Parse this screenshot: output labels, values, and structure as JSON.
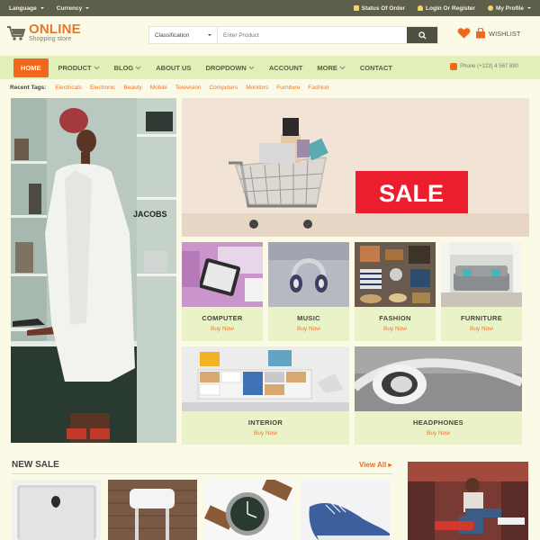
{
  "topbar": {
    "language": "Language",
    "currency": "Currency",
    "status": "Status Of Order",
    "login": "Login Or Register",
    "profile": "My Profile"
  },
  "header": {
    "logo_name": "ONLINE",
    "logo_sub": "Shopping store",
    "search_category": "Classification",
    "search_placeholder": "Enter Product",
    "wishlist": "WISHLIST"
  },
  "nav": {
    "items": [
      "HOME",
      "PRODUCT",
      "BLOG",
      "ABOUT US",
      "DROPDOWN",
      "ACCOUNT",
      "MORE",
      "CONTACT"
    ],
    "phone": "Phone (+123) 4 567 890"
  },
  "tags": {
    "label": "Recent Tags:",
    "items": [
      "Electricals",
      "Electronic",
      "Beauty",
      "Mobile",
      "Television",
      "Computers",
      "Monitors",
      "Furniture",
      "Fashion"
    ]
  },
  "banner": {
    "sale_text": "SALE",
    "store_sign": "JACOBS"
  },
  "categories": {
    "computer": "COMPUTER",
    "music": "MUSIC",
    "fashion": "FASHION",
    "furniture": "FURNITURE",
    "interior": "INTERIOR",
    "headphones": "HEADPHONES",
    "buy_now": "Buy Now"
  },
  "new_sale": {
    "title": "NEW SALE",
    "view_all": "View All"
  },
  "colors": {
    "accent": "#f0681e",
    "topbar": "#5d5e4b",
    "nav": "#e3efb8",
    "card": "#eaf2c8"
  }
}
